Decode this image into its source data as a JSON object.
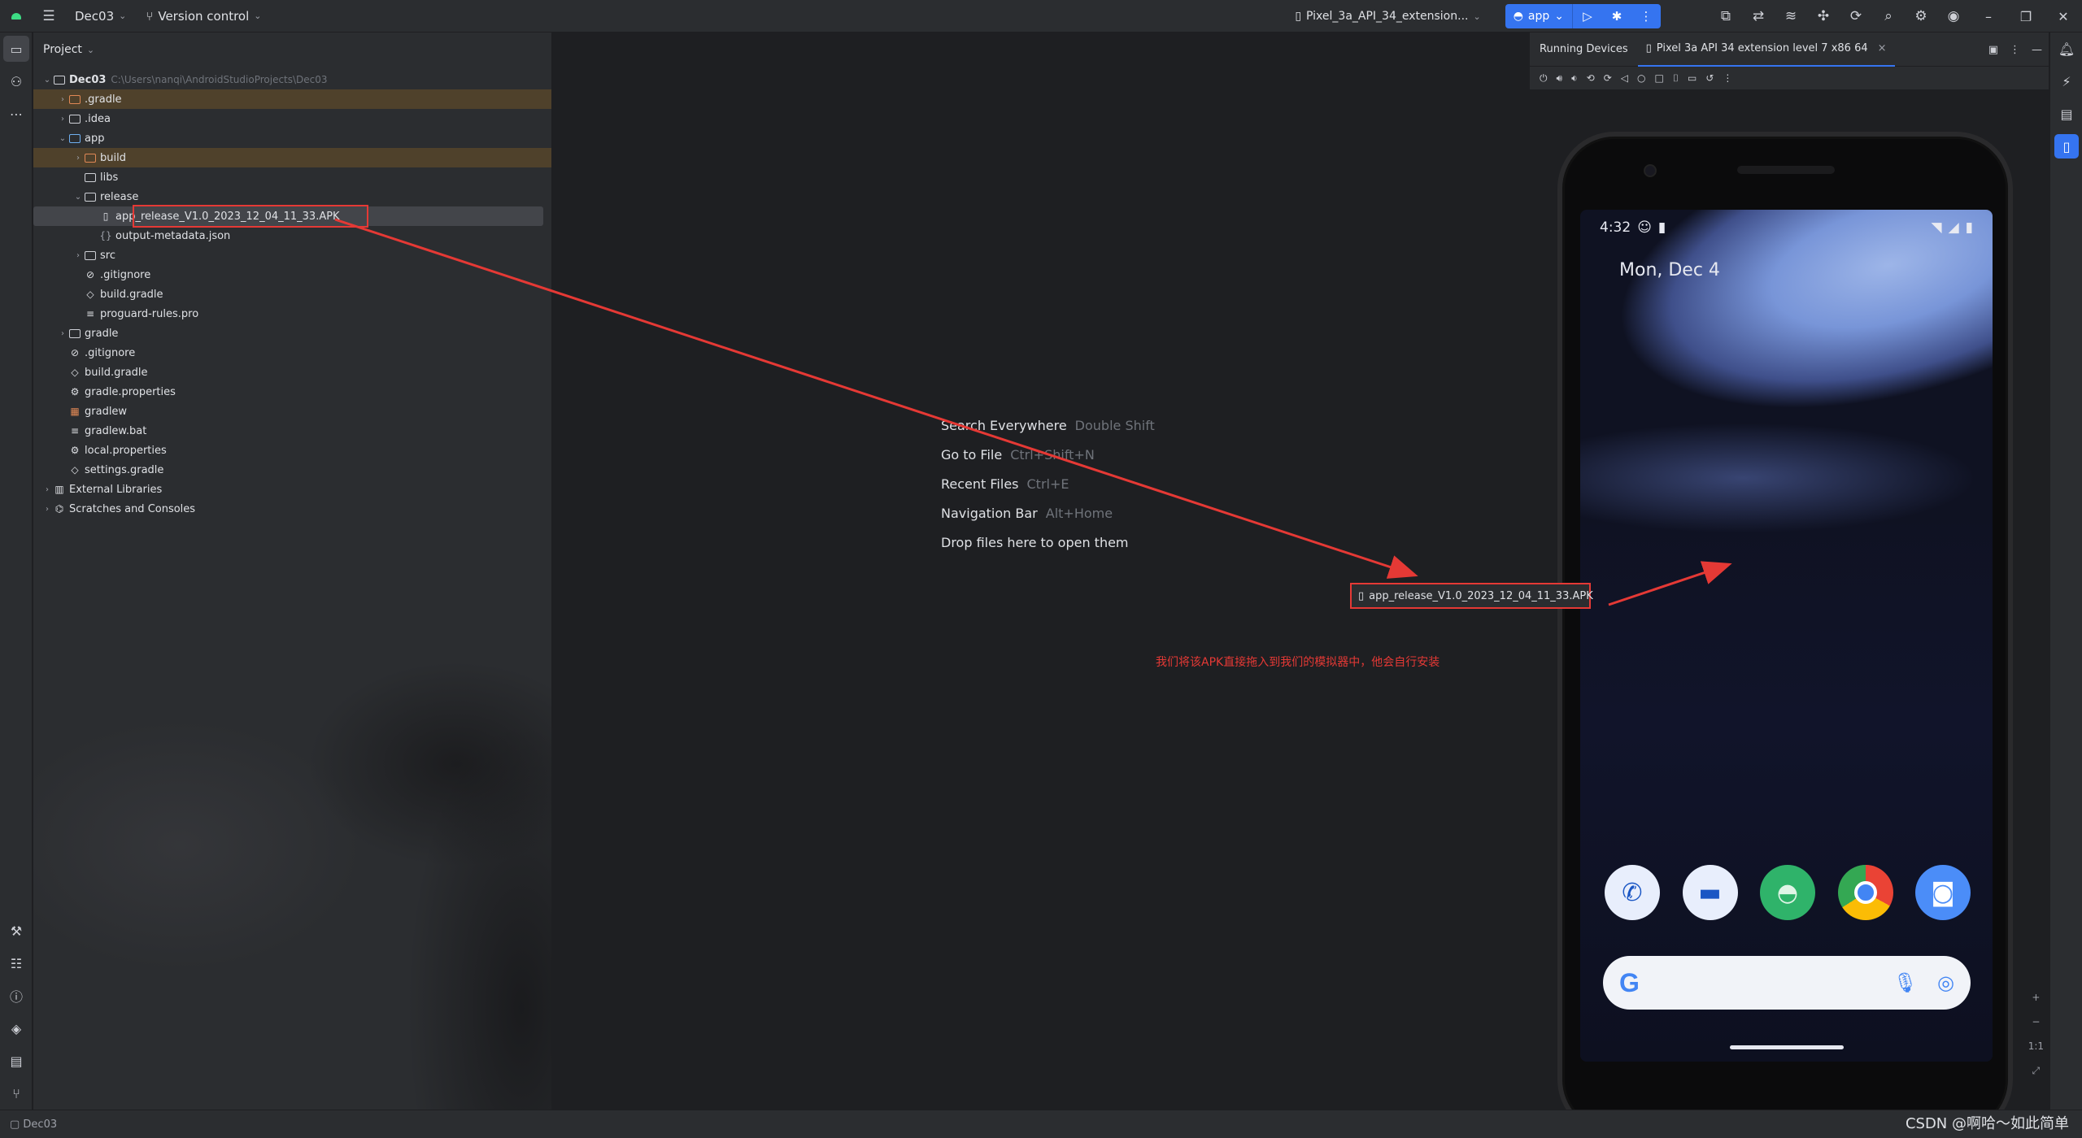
{
  "titlebar": {
    "project": "Dec03",
    "vcs": "Version control",
    "device": "Pixel_3a_API_34_extension...",
    "run_config": "app"
  },
  "project_panel": {
    "title": "Project",
    "root_name": "Dec03",
    "root_path": "C:\\Users\\nanqi\\AndroidStudioProjects\\Dec03",
    "items": [
      {
        "label": ".gradle",
        "depth": 1,
        "arrow": "›",
        "icon": "folder-orange",
        "excluded": true
      },
      {
        "label": ".idea",
        "depth": 1,
        "arrow": "›",
        "icon": "folder"
      },
      {
        "label": "app",
        "depth": 1,
        "arrow": "⌄",
        "icon": "folder-module"
      },
      {
        "label": "build",
        "depth": 2,
        "arrow": "›",
        "icon": "folder-orange",
        "excluded": true
      },
      {
        "label": "libs",
        "depth": 2,
        "arrow": "",
        "icon": "folder"
      },
      {
        "label": "release",
        "depth": 2,
        "arrow": "⌄",
        "icon": "folder"
      },
      {
        "label": "app_release_V1.0_2023_12_04_11_33.APK",
        "depth": 3,
        "arrow": "",
        "icon": "file-apk",
        "selected": true
      },
      {
        "label": "output-metadata.json",
        "depth": 3,
        "arrow": "",
        "icon": "file-json"
      },
      {
        "label": "src",
        "depth": 2,
        "arrow": "›",
        "icon": "folder"
      },
      {
        "label": ".gitignore",
        "depth": 2,
        "arrow": "",
        "icon": "file-ignore"
      },
      {
        "label": "build.gradle",
        "depth": 2,
        "arrow": "",
        "icon": "file-gradle"
      },
      {
        "label": "proguard-rules.pro",
        "depth": 2,
        "arrow": "",
        "icon": "file-text"
      },
      {
        "label": "gradle",
        "depth": 1,
        "arrow": "›",
        "icon": "folder"
      },
      {
        "label": ".gitignore",
        "depth": 1,
        "arrow": "",
        "icon": "file-ignore"
      },
      {
        "label": "build.gradle",
        "depth": 1,
        "arrow": "",
        "icon": "file-gradle"
      },
      {
        "label": "gradle.properties",
        "depth": 1,
        "arrow": "",
        "icon": "file-settings"
      },
      {
        "label": "gradlew",
        "depth": 1,
        "arrow": "",
        "icon": "file-script"
      },
      {
        "label": "gradlew.bat",
        "depth": 1,
        "arrow": "",
        "icon": "file-text"
      },
      {
        "label": "local.properties",
        "depth": 1,
        "arrow": "",
        "icon": "file-settings"
      },
      {
        "label": "settings.gradle",
        "depth": 1,
        "arrow": "",
        "icon": "file-gradle"
      },
      {
        "label": "External Libraries",
        "depth": 0,
        "arrow": "›",
        "icon": "library"
      },
      {
        "label": "Scratches and Consoles",
        "depth": 0,
        "arrow": "›",
        "icon": "scratches"
      }
    ]
  },
  "editor_hints": [
    {
      "action": "Search Everywhere",
      "key": "Double Shift"
    },
    {
      "action": "Go to File",
      "key": "Ctrl+Shift+N"
    },
    {
      "action": "Recent Files",
      "key": "Ctrl+E"
    },
    {
      "action": "Navigation Bar",
      "key": "Alt+Home"
    },
    {
      "action": "Drop files here to open them",
      "key": ""
    }
  ],
  "devices_panel": {
    "title": "Running Devices",
    "tab": "Pixel 3a API 34 extension level 7 x86 64"
  },
  "phone": {
    "time": "4:32",
    "date": "Mon, Dec 4"
  },
  "annotation": {
    "drag_file": "app_release_V1.0_2023_12_04_11_33.APK",
    "note": "我们将该APK直接拖入到我们的模拟器中，他会自行安装"
  },
  "statusbar": {
    "project": "Dec03",
    "watermark": "CSDN @啊哈～如此简单"
  },
  "colors": {
    "accent": "#3574f0",
    "annotation": "#e53935",
    "excluded": "#7c5c26"
  }
}
